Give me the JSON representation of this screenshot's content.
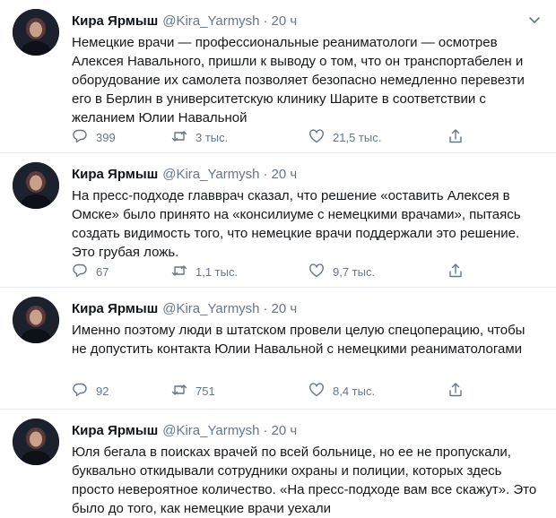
{
  "tweets": [
    {
      "author_name": "Кира Ярмыш",
      "handle": "@Kira_Yarmysh",
      "separator": "·",
      "time": "20 ч",
      "text": "Немецкие врачи — профессиональные реаниматологи — осмотрев Алексея Навального, пришли к выводу о том, что он транспортабелен и оборудование их самолета позволяет безопасно немедленно перевезти его в Берлин в университетскую клинику Шарите в соответствии с желанием Юлии Навальной",
      "replies": "399",
      "retweets": "3 тыс.",
      "likes": "21,5 тыс."
    },
    {
      "author_name": "Кира Ярмыш",
      "handle": "@Kira_Yarmysh",
      "separator": "·",
      "time": "20 ч",
      "text": "На пресс-подходе главврач сказал, что решение «оставить Алексея в Омске» было принято на «консилиуме с немецкими врачами», пытаясь создать видимость того, что немецкие врачи поддержали это решение. Это грубая ложь.",
      "replies": "67",
      "retweets": "1,1 тыс.",
      "likes": "9,7 тыс."
    },
    {
      "author_name": "Кира Ярмыш",
      "handle": "@Kira_Yarmysh",
      "separator": "·",
      "time": "20 ч",
      "text": "Именно поэтому люди в штатском провели целую спецоперацию, чтобы не допустить контакта Юлии Навальной с немецкими реаниматологами",
      "replies": "92",
      "retweets": "751",
      "likes": "8,4 тыс."
    },
    {
      "author_name": "Кира Ярмыш",
      "handle": "@Kira_Yarmysh",
      "separator": "·",
      "time": "20 ч",
      "text": "Юля бегала в поисках врачей по всей больнице, но ее не пропускали, буквально откидывали сотрудники охраны и полиции, которых здесь просто невероятное количество. «На пресс-подходе вам все скажут». Это было до того, как немецкие врачи уехали"
    }
  ],
  "icons": {
    "caret": "chevron-down-icon",
    "reply": "reply-icon",
    "retweet": "retweet-icon",
    "like": "heart-icon",
    "share": "share-icon"
  },
  "colors": {
    "name": "#0f1419",
    "muted": "#657786",
    "divider": "#e6ecf0"
  }
}
